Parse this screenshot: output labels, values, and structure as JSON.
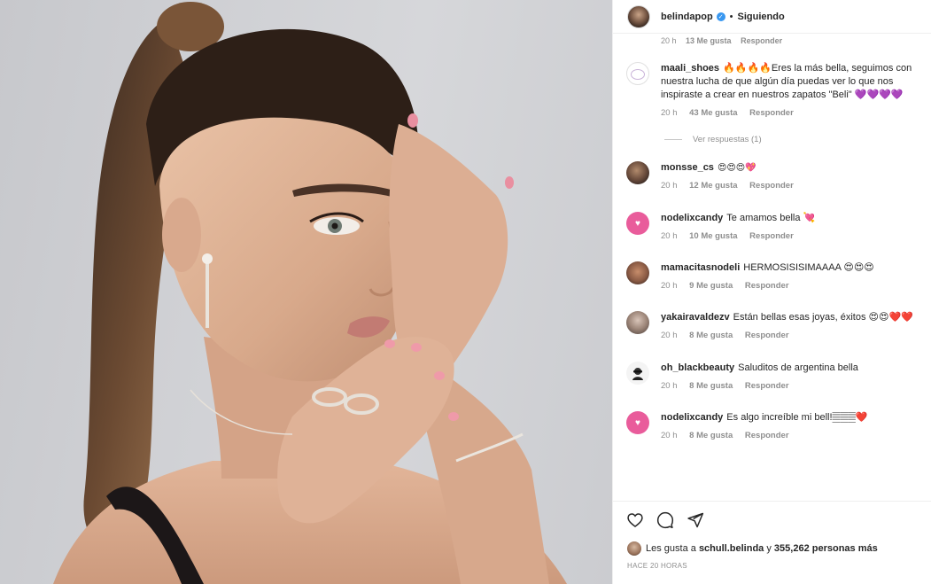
{
  "post": {
    "author": "belindapop",
    "separator": "•",
    "follow_status": "Siguiendo",
    "verified_mark": "✓"
  },
  "top_cut_meta": {
    "time": "20 h",
    "likes": "13 Me gusta",
    "reply": "Responder"
  },
  "comments": [
    {
      "user": "maali_shoes",
      "text": "🔥🔥🔥🔥Eres la más bella, seguimos con nuestra lucha de que algún día puedas ver lo que nos inspiraste a crear en nuestros zapatos \"Beli\" 💜💜💜💜",
      "time": "20 h",
      "likes": "43 Me gusta",
      "reply": "Responder"
    },
    {
      "user": "monsse_cs",
      "text": "😍😍😍💖",
      "time": "20 h",
      "likes": "12 Me gusta",
      "reply": "Responder"
    },
    {
      "user": "nodelixcandy",
      "text": "Te amamos bella 💘",
      "time": "20 h",
      "likes": "10 Me gusta",
      "reply": "Responder"
    },
    {
      "user": "mamacitasnodeli",
      "text": "HERMOSISISIMAAAA 😍😍😍",
      "time": "20 h",
      "likes": "9 Me gusta",
      "reply": "Responder"
    },
    {
      "user": "yakairavaldezv",
      "text": "Están bellas esas joyas, éxitos 😍😍❤️❤️",
      "time": "20 h",
      "likes": "8 Me gusta",
      "reply": "Responder"
    },
    {
      "user": "oh_blackbeauty",
      "text": "Saluditos de argentina bella",
      "time": "20 h",
      "likes": "8 Me gusta",
      "reply": "Responder"
    },
    {
      "user": "nodelixcandy",
      "text": "Es algo increíble mi bell!𝄛𝄛𝄛❤️",
      "time": "20 h",
      "likes": "8 Me gusta",
      "reply": "Responder"
    }
  ],
  "view_replies": "Ver respuestas (1)",
  "likes_summary": {
    "prefix": "Les gusta a",
    "user": "schull.belinda",
    "connector": "y",
    "count": "355,262 personas más"
  },
  "timestamp": "HACE 20 HORAS",
  "icons": {
    "like": "heart-outline-icon",
    "comment": "speech-bubble-icon",
    "share": "paper-plane-icon",
    "heart_avatar": "♥"
  },
  "colors": {
    "verified": "#3897f0",
    "muted_text": "#8e8e8e",
    "primary_text": "#262626",
    "heart_avatar": "#e95c9b"
  }
}
